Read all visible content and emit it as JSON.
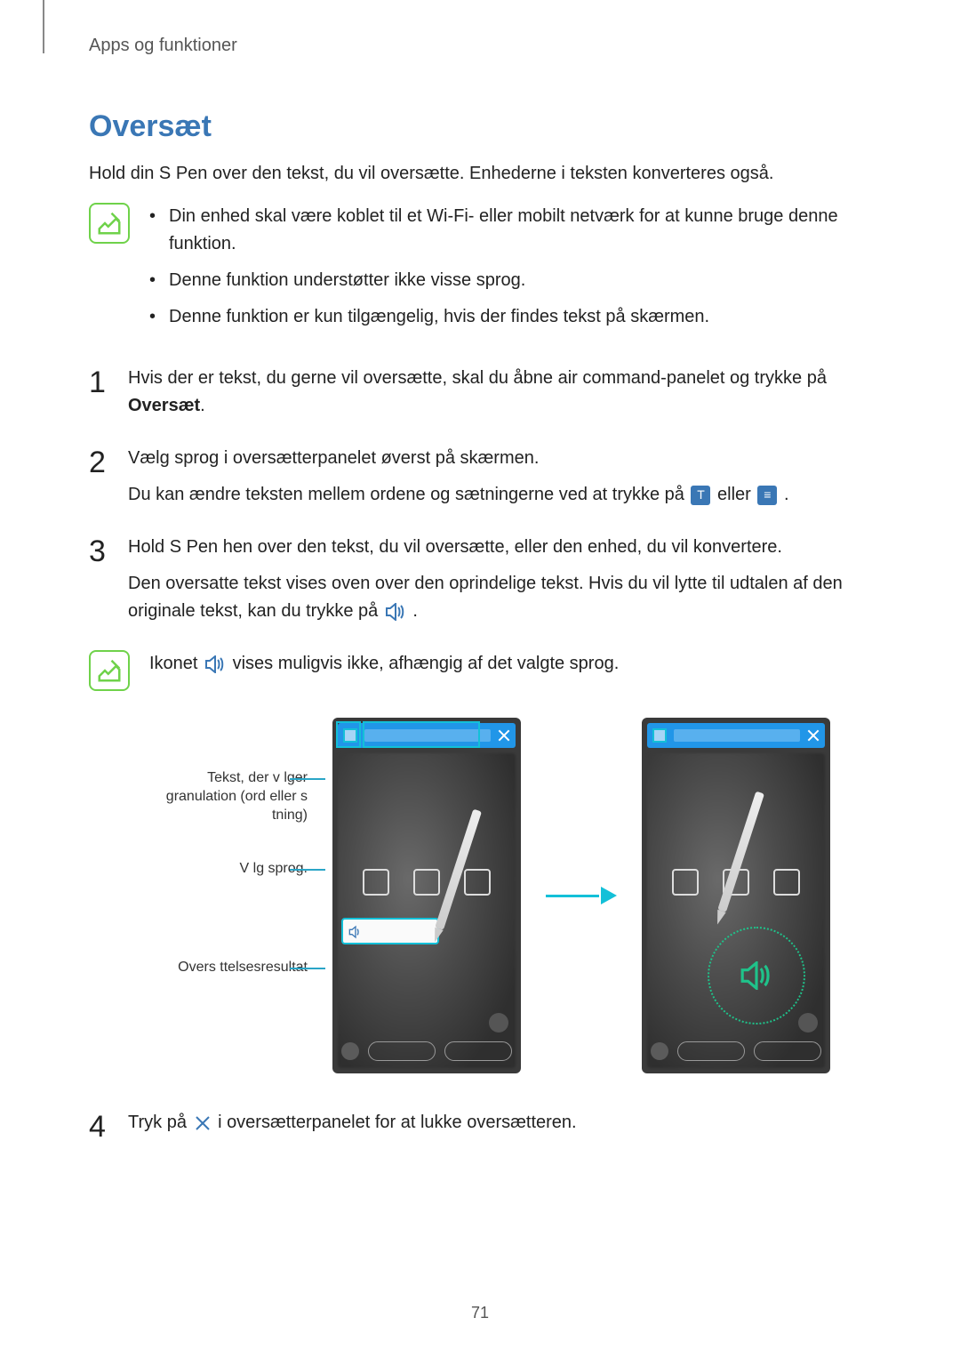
{
  "header": {
    "breadcrumb": "Apps og funktioner"
  },
  "section": {
    "title": "Oversæt",
    "intro": "Hold din S Pen over den tekst, du vil oversætte. Enhederne i teksten konverteres også."
  },
  "note1": {
    "items": [
      "Din enhed skal være koblet til et Wi-Fi- eller mobilt netværk for at kunne bruge denne funktion.",
      "Denne funktion understøtter ikke visse sprog.",
      "Denne funktion er kun tilgængelig, hvis der findes tekst på skærmen."
    ]
  },
  "steps": {
    "s1": {
      "num": "1",
      "text_a": "Hvis der er tekst, du gerne vil oversætte, skal du åbne air command-panelet og trykke på ",
      "bold": "Oversæt",
      "text_b": "."
    },
    "s2": {
      "num": "2",
      "line1": "Vælg sprog i oversætterpanelet øverst på skærmen.",
      "line2_a": "Du kan ændre teksten mellem ordene og sætningerne ved at trykke på ",
      "line2_b": " eller ",
      "line2_c": "."
    },
    "s3": {
      "num": "3",
      "line1": "Hold S Pen hen over den tekst, du vil oversætte, eller den enhed, du vil konvertere.",
      "line2_a": "Den oversatte tekst vises oven over den oprindelige tekst. Hvis du vil lytte til udtalen af den originale tekst, kan du trykke på ",
      "line2_b": "."
    },
    "s4": {
      "num": "4",
      "text_a": "Tryk på ",
      "text_b": " i oversætterpanelet for at lukke oversætteren."
    }
  },
  "note2": {
    "text_a": "Ikonet ",
    "text_b": " vises muligvis ikke, afhængig af det valgte sprog."
  },
  "callouts": {
    "c1": "Tekst, der v lger granulation (ord eller s tning)",
    "c2": "V lg sprog.",
    "c3": "Overs ttelsesresultat"
  },
  "inline_icons": {
    "t_letter": "T",
    "lines": "≡"
  },
  "page_number": "71"
}
